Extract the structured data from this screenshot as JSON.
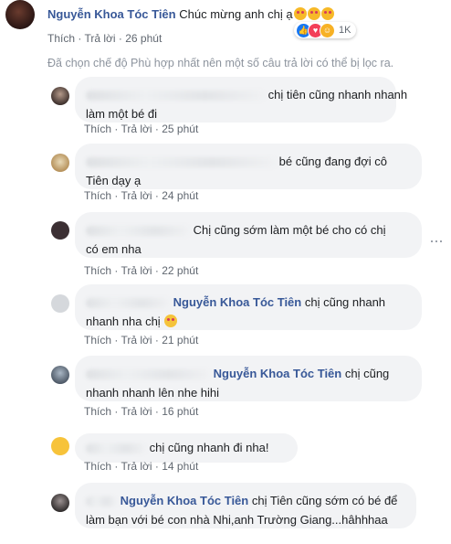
{
  "top": {
    "name": "Nguyễn Khoa Tóc Tiên",
    "text": "Chúc mừng anh chị ạ",
    "like": "Thích",
    "reply": "Trả lời",
    "time": "26 phút",
    "reaction_count": "1K"
  },
  "notice": "Đã chọn chế độ Phù hợp nhất nên một số câu trả lời có thể bị lọc ra.",
  "replies": [
    {
      "line1": "chị tiên cũng nhanh nhanh",
      "line2": "làm một bé đi",
      "like": "Thích",
      "reply": "Trả lời",
      "time": "25 phút"
    },
    {
      "line1": "bé cũng đang đợi cô",
      "line2": "Tiên dạy ạ",
      "like": "Thích",
      "reply": "Trả lời",
      "time": "24 phút"
    },
    {
      "line1": "Chị cũng sớm làm một bé cho có chị",
      "line2": "có em nha",
      "like": "Thích",
      "reply": "Trả lời",
      "time": "22 phút"
    },
    {
      "name": "Nguyễn Khoa Tóc Tiên",
      "line1": "chị cũng nhanh",
      "line2": "nhanh nha chị",
      "like": "Thích",
      "reply": "Trả lời",
      "time": "21 phút"
    },
    {
      "name": "Nguyễn Khoa Tóc Tiên",
      "line1": "chị cũng",
      "line2": "nhanh nhanh lên nhe hihi",
      "like": "Thích",
      "reply": "Trả lời",
      "time": "16 phút"
    },
    {
      "line1": "chị cũng nhanh đi nha!",
      "like": "Thích",
      "reply": "Trả lời",
      "time": "14 phút"
    },
    {
      "name": "Nguyễn Khoa Tóc Tiên",
      "line1": "chị Tiên cũng sớm có bé để",
      "line2": "làm bạn với bé con nhà Nhi,anh Trường Giang...hâhhhaa"
    }
  ],
  "icons": {
    "love_emoji": "smiling-face-with-hearts-icon",
    "reactions": [
      "like-icon",
      "love-icon",
      "haha-icon"
    ],
    "more": "more-options-icon"
  }
}
